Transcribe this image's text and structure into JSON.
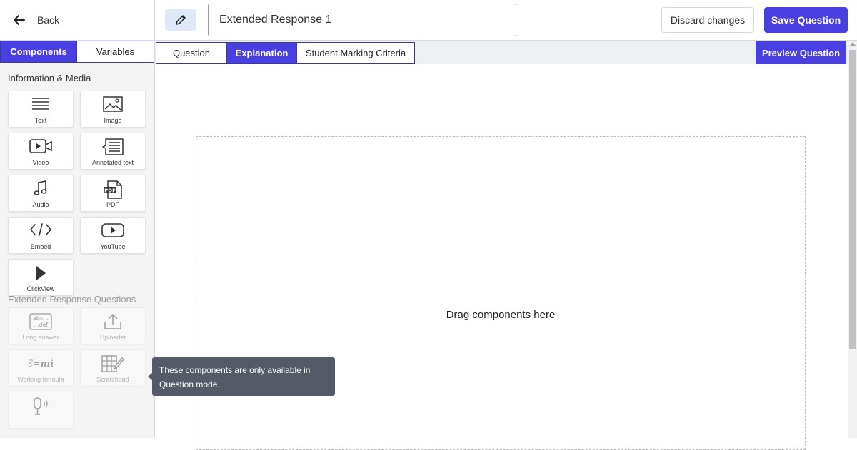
{
  "header": {
    "back_label": "Back",
    "title_value": "Extended Response 1",
    "discard_label": "Discard changes",
    "save_label": "Save Question"
  },
  "sidebar": {
    "tabs": [
      {
        "label": "Components",
        "active": true
      },
      {
        "label": "Variables",
        "active": false
      }
    ],
    "sections": [
      {
        "title": "Information & Media",
        "items": [
          {
            "label": "Text",
            "icon": "text-lines-icon"
          },
          {
            "label": "Image",
            "icon": "image-icon"
          },
          {
            "label": "Video",
            "icon": "video-camera-icon"
          },
          {
            "label": "Annotated text",
            "icon": "annotated-text-icon"
          },
          {
            "label": "Audio",
            "icon": "music-note-icon"
          },
          {
            "label": "PDF",
            "icon": "pdf-file-icon"
          },
          {
            "label": "Embed",
            "icon": "code-brackets-icon"
          },
          {
            "label": "YouTube",
            "icon": "youtube-play-icon"
          },
          {
            "label": "ClickView",
            "icon": "clickview-play-icon"
          }
        ]
      },
      {
        "title": "Extended Response Questions",
        "disabled": true,
        "items": [
          {
            "label": "Long answer",
            "icon": "long-answer-icon"
          },
          {
            "label": "Uploader",
            "icon": "upload-icon"
          },
          {
            "label": "Working formula",
            "icon": "formula-icon"
          },
          {
            "label": "Scratchpad",
            "icon": "scratchpad-icon"
          },
          {
            "label": "",
            "icon": "microphone-icon"
          }
        ]
      }
    ]
  },
  "editor": {
    "tabs": [
      {
        "label": "Question",
        "active": false
      },
      {
        "label": "Explanation",
        "active": true
      },
      {
        "label": "Student Marking Criteria",
        "active": false
      }
    ],
    "preview_label": "Preview Question",
    "dropzone_text": "Drag components here"
  },
  "tooltip": {
    "text": "These components are only available in Question mode."
  },
  "colors": {
    "accent": "#4a3fe0",
    "tooltip_bg": "#555b66",
    "edit_button_bg": "#dfe8f7"
  }
}
